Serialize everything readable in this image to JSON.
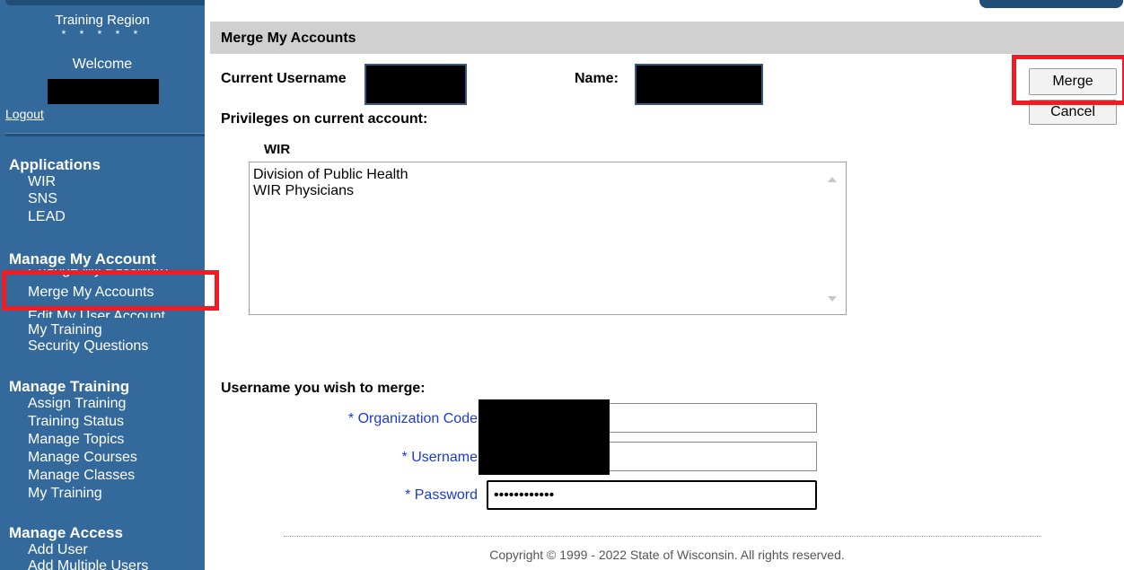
{
  "sidebar": {
    "region_title": "Training Region",
    "stars": "* * * * *",
    "welcome": "Welcome",
    "logout": "Logout",
    "sections": [
      {
        "title": "Applications",
        "items": [
          "WIR",
          "SNS",
          "LEAD"
        ]
      },
      {
        "title": "Manage My Account",
        "items": [
          "Change My Password",
          "Merge My Accounts",
          "Edit My User Account",
          "My Training",
          "Security Questions"
        ]
      },
      {
        "title": "Manage Training",
        "items": [
          "Assign Training",
          "Training Status",
          "Manage Topics",
          "Manage Courses",
          "Manage Classes",
          "My Training"
        ]
      },
      {
        "title": "Manage Access",
        "items": [
          "Add User",
          "Add Multiple Users"
        ]
      }
    ]
  },
  "page": {
    "title": "Merge My Accounts",
    "current_username_label": "Current Username",
    "name_label": "Name:",
    "privileges_label": "Privileges on current account:",
    "wir_label": "WIR",
    "wir_privileges": [
      "Division of Public Health",
      "WIR Physicians"
    ],
    "merge_button": "Merge",
    "cancel_button": "Cancel",
    "merge_section_label": "Username you wish to merge:",
    "org_code_label": "* Organization Code",
    "username_label": "* Username",
    "password_label": "* Password",
    "password_value": "••••••••••••",
    "copyright": "Copyright © 1999 - 2022 State of Wisconsin. All rights reserved."
  },
  "colors": {
    "sidebar_bg": "#346a9b",
    "highlight": "#ef1c24",
    "required_label": "#1a3bd1"
  }
}
